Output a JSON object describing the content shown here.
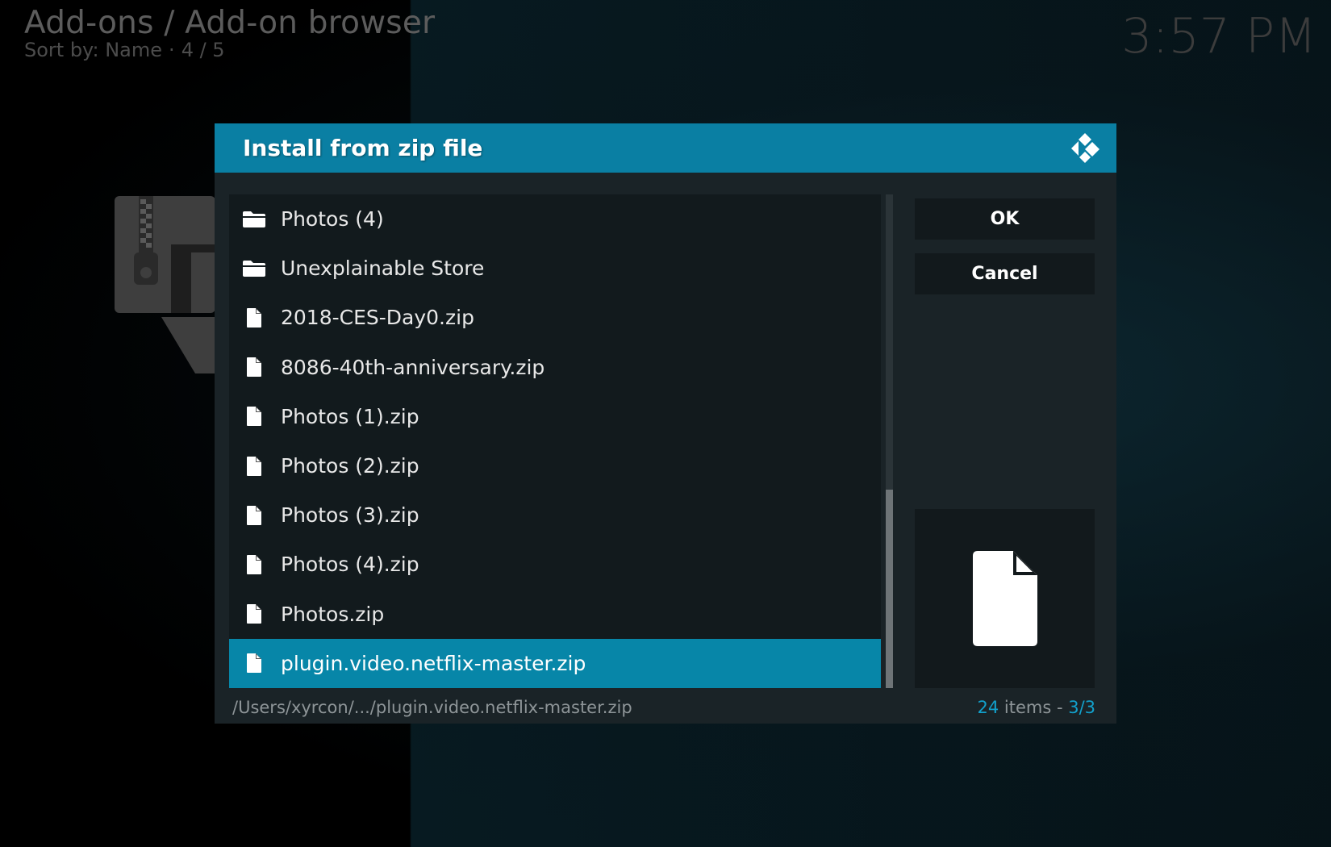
{
  "header": {
    "title": "Add-ons / Add-on browser",
    "sort_label": "Sort by: Name",
    "separator": "·",
    "position": "4 / 5",
    "clock": "3:57 PM"
  },
  "dialog": {
    "title": "Install from zip file",
    "items": [
      {
        "label": "Photos (4)",
        "type": "folder",
        "selected": false
      },
      {
        "label": "Unexplainable Store",
        "type": "folder",
        "selected": false
      },
      {
        "label": "2018-CES-Day0.zip",
        "type": "file",
        "selected": false
      },
      {
        "label": "8086-40th-anniversary.zip",
        "type": "file",
        "selected": false
      },
      {
        "label": "Photos (1).zip",
        "type": "file",
        "selected": false
      },
      {
        "label": "Photos (2).zip",
        "type": "file",
        "selected": false
      },
      {
        "label": "Photos (3).zip",
        "type": "file",
        "selected": false
      },
      {
        "label": "Photos (4).zip",
        "type": "file",
        "selected": false
      },
      {
        "label": "Photos.zip",
        "type": "file",
        "selected": false
      },
      {
        "label": "plugin.video.netflix-master.zip",
        "type": "file",
        "selected": true
      }
    ],
    "ok_label": "OK",
    "cancel_label": "Cancel",
    "path": "/Users/xyrcon/.../plugin.video.netflix-master.zip",
    "item_count": "24",
    "items_word": " items - ",
    "page": "3/3",
    "preview_icon": "file-icon"
  },
  "colors": {
    "accent": "#0a7fa3",
    "selection": "#0786a8",
    "highlight_text": "#12a0cb"
  }
}
